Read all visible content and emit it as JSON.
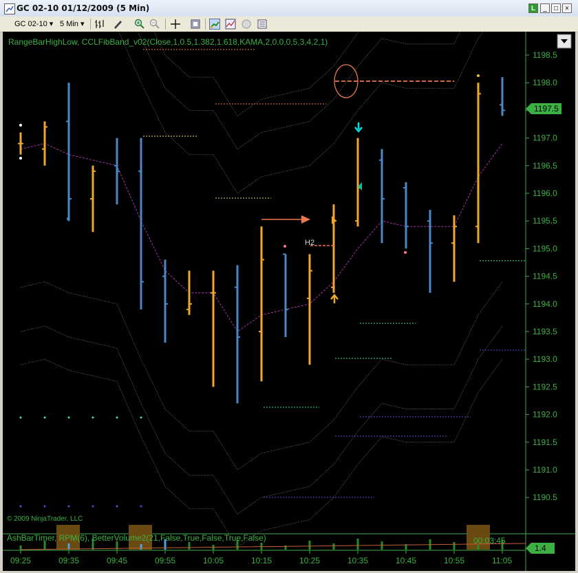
{
  "window": {
    "title": "GC 02-10  01/12/2009 (5 Min)",
    "buttons": {
      "indicator": "L",
      "minimize": "_",
      "maximize": "□",
      "close": "×"
    }
  },
  "toolbar": {
    "instrument": "GC 02-10",
    "interval": "5 Min",
    "icons": [
      "bar-type-icon",
      "draw-tools-icon",
      "zoom-in-icon",
      "zoom-out-icon",
      "crosshair-icon",
      "properties-icon",
      "strategy-icon",
      "indicators-icon",
      "refresh-icon",
      "data-box-icon"
    ]
  },
  "chart": {
    "indicator_label": "RangeBarHighLow, CCLFibBand_v02(Close,1,0.5,1.382,1.618,KAMA,2,0,0,0,5,3,4,2,1)",
    "copyright": "© 2009 NinjaTrader, LLC",
    "lower_panel_label": "AshBarTimer, RPM(6), BetterVolume2(21,False,True,False,True,False)",
    "timer_text": "00:03:45",
    "lower_value": "1.4",
    "current_price": "1197.5",
    "pattern_label": "H2",
    "colors": {
      "up": "#f0a830",
      "down": "#4a88c8",
      "axis": "#3cb043",
      "kama": "#b030b0",
      "band": "#7a7a7a"
    }
  },
  "chart_data": {
    "type": "ohlc",
    "y_axis_ticks": [
      "1198.5",
      "1198.0",
      "1197.5",
      "1197.0",
      "1196.5",
      "1196.0",
      "1195.5",
      "1195.0",
      "1194.5",
      "1194.0",
      "1193.5",
      "1193.0",
      "1192.5",
      "1192.0",
      "1191.5",
      "1191.0",
      "1190.5"
    ],
    "x_axis_ticks": [
      "09:25",
      "09:35",
      "09:45",
      "09:55",
      "10:05",
      "10:15",
      "10:25",
      "10:35",
      "10:45",
      "10:55",
      "11:05"
    ],
    "ylim": [
      1190.2,
      1198.8
    ],
    "bars": [
      {
        "i": 0,
        "o": 1196.9,
        "h": 1197.1,
        "l": 1196.7,
        "c": 1196.9,
        "dir": "up"
      },
      {
        "i": 1,
        "o": 1196.8,
        "h": 1197.3,
        "l": 1196.5,
        "c": 1197.2,
        "dir": "up"
      },
      {
        "i": 2,
        "o": 1197.3,
        "h": 1198.0,
        "l": 1195.5,
        "c": 1195.9,
        "dir": "down"
      },
      {
        "i": 3,
        "o": 1195.9,
        "h": 1196.5,
        "l": 1195.3,
        "c": 1196.4,
        "dir": "up"
      },
      {
        "i": 4,
        "o": 1196.5,
        "h": 1197.0,
        "l": 1195.8,
        "c": 1196.4,
        "dir": "down"
      },
      {
        "i": 5,
        "o": 1196.4,
        "h": 1197.0,
        "l": 1193.9,
        "c": 1194.4,
        "dir": "down"
      },
      {
        "i": 6,
        "o": 1194.5,
        "h": 1194.8,
        "l": 1193.3,
        "c": 1194.0,
        "dir": "down"
      },
      {
        "i": 7,
        "o": 1193.9,
        "h": 1194.6,
        "l": 1193.8,
        "c": 1194.0,
        "dir": "up"
      },
      {
        "i": 8,
        "o": 1194.2,
        "h": 1194.6,
        "l": 1192.5,
        "c": 1194.2,
        "dir": "up"
      },
      {
        "i": 9,
        "o": 1194.3,
        "h": 1194.7,
        "l": 1192.2,
        "c": 1193.4,
        "dir": "down"
      },
      {
        "i": 10,
        "o": 1193.5,
        "h": 1195.4,
        "l": 1192.6,
        "c": 1194.8,
        "dir": "up"
      },
      {
        "i": 11,
        "o": 1194.9,
        "h": 1194.9,
        "l": 1193.4,
        "c": 1193.9,
        "dir": "down"
      },
      {
        "i": 12,
        "o": 1194.1,
        "h": 1194.9,
        "l": 1192.9,
        "c": 1194.6,
        "dir": "up"
      },
      {
        "i": 13,
        "o": 1194.3,
        "h": 1195.8,
        "l": 1194.2,
        "c": 1195.5,
        "dir": "up"
      },
      {
        "i": 14,
        "o": 1195.5,
        "h": 1197.0,
        "l": 1195.4,
        "c": 1196.1,
        "dir": "up"
      },
      {
        "i": 15,
        "o": 1196.6,
        "h": 1196.8,
        "l": 1195.1,
        "c": 1195.9,
        "dir": "down"
      },
      {
        "i": 16,
        "o": 1196.1,
        "h": 1196.2,
        "l": 1195.0,
        "c": 1195.4,
        "dir": "down"
      },
      {
        "i": 17,
        "o": 1195.5,
        "h": 1195.7,
        "l": 1194.2,
        "c": 1195.1,
        "dir": "down"
      },
      {
        "i": 18,
        "o": 1195.1,
        "h": 1195.6,
        "l": 1194.4,
        "c": 1195.4,
        "dir": "up"
      },
      {
        "i": 19,
        "o": 1195.4,
        "h": 1198.0,
        "l": 1195.1,
        "c": 1197.8,
        "dir": "up"
      },
      {
        "i": 20,
        "o": 1197.6,
        "h": 1198.1,
        "l": 1197.4,
        "c": 1197.5,
        "dir": "down"
      }
    ],
    "kama": [
      1196.8,
      1196.9,
      1196.7,
      1196.6,
      1196.5,
      1195.5,
      1194.6,
      1194.2,
      1194.2,
      1193.5,
      1193.8,
      1193.9,
      1194.0,
      1194.4,
      1195.0,
      1195.5,
      1195.4,
      1195.4,
      1195.4,
      1196.3,
      1196.9
    ]
  }
}
